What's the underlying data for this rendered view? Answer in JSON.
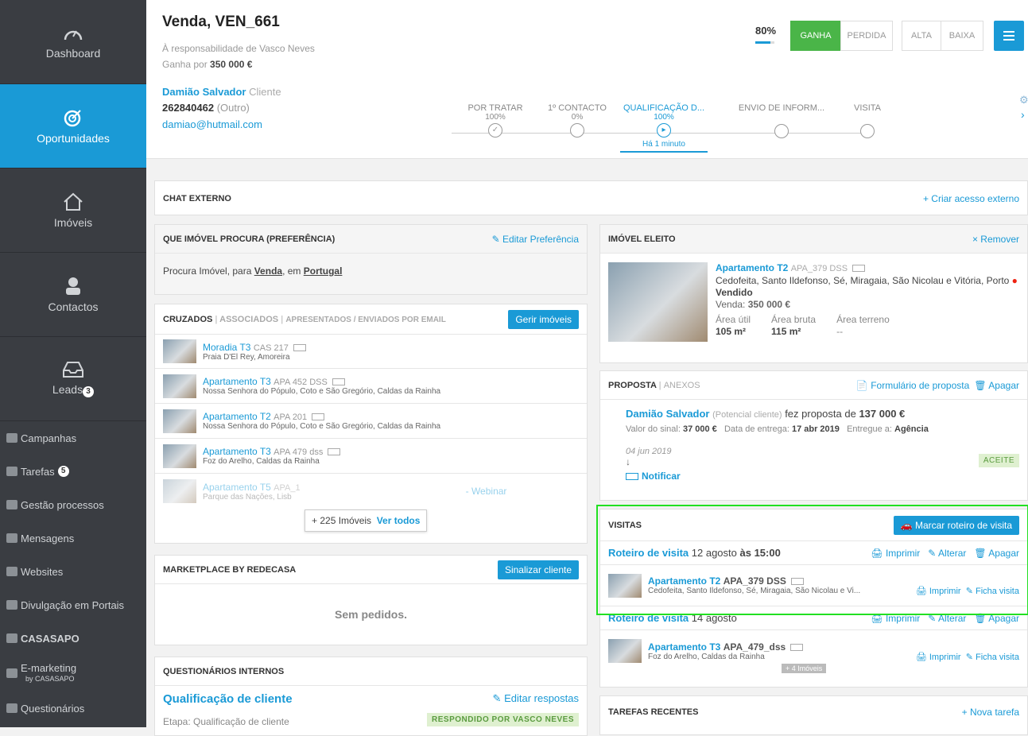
{
  "sidebar": {
    "big": [
      {
        "label": "Dashboard",
        "icon": "gauge-icon"
      },
      {
        "label": "Oportunidades",
        "icon": "target-icon"
      },
      {
        "label": "Imóveis",
        "icon": "house-icon"
      },
      {
        "label": "Contactos",
        "icon": "person-icon"
      },
      {
        "label": "Leads",
        "icon": "inbox-icon",
        "badge": "3"
      }
    ],
    "small": [
      {
        "label": "Campanhas"
      },
      {
        "label": "Tarefas",
        "badge": "5"
      },
      {
        "label": "Gestão processos"
      },
      {
        "label": "Mensagens"
      },
      {
        "label": "Websites"
      },
      {
        "label": "Divulgação em Portais"
      },
      {
        "label": "CASASAPO"
      },
      {
        "label": "E-marketing",
        "sub": "by CASASAPO"
      },
      {
        "label": "Questionários"
      }
    ]
  },
  "header": {
    "title": "Venda, VEN_661",
    "responsible": "À responsabilidade de Vasco Neves",
    "won_prefix": "Ganha por ",
    "won_value": "350 000 €",
    "client_name": "Damião Salvador",
    "client_type": "Cliente",
    "phone": "262840462",
    "phone_type": "(Outro)",
    "email": "damiao@hutmail.com",
    "percent": "80%",
    "btn_won": "GANHA",
    "btn_lost": "PERDIDA",
    "btn_high": "ALTA",
    "btn_low": "BAIXA"
  },
  "stages": [
    {
      "name": "POR TRATAR",
      "pct": "100%"
    },
    {
      "name": "1º CONTACTO",
      "pct": "0%"
    },
    {
      "name": "QUALIFICAÇÃO D...",
      "pct": "100%",
      "when": "Há 1 minuto"
    },
    {
      "name": "ENVIO DE INFORM...",
      "pct": ""
    },
    {
      "name": "VISITA",
      "pct": ""
    }
  ],
  "chat": {
    "title": "CHAT EXTERNO",
    "action": "+ Criar acesso externo"
  },
  "pref": {
    "title": "QUE IMÓVEL PROCURA (PREFERÊNCIA)",
    "action": "Editar Preferência",
    "t1": "Procura Imóvel, para ",
    "venda": "Venda",
    "t2": ", em ",
    "pais": "Portugal"
  },
  "cross": {
    "tab1": "CRUZADOS",
    "tab2": "ASSOCIADOS",
    "tab3": "APRESENTADOS / ENVIADOS POR EMAIL",
    "btn": "Gerir imóveis",
    "items": [
      {
        "title": "Moradia T3",
        "ref": "CAS  217",
        "loc": "Praia D'El Rey, Amoreira"
      },
      {
        "title": "Apartamento T3",
        "ref": "APA  452  DSS",
        "loc": "Nossa Senhora do Pópulo, Coto e São Gregório, Caldas da Rainha"
      },
      {
        "title": "Apartamento T2",
        "ref": "APA  201",
        "loc": "Nossa Senhora do Pópulo, Coto e São Gregório, Caldas da Rainha"
      },
      {
        "title": "Apartamento T3",
        "ref": "APA  479  dss",
        "loc": "Foz do Arelho, Caldas da Rainha"
      },
      {
        "title": "Apartamento T5",
        "ref": "APA_1",
        "loc": "Parque das Nações, Lisb"
      }
    ],
    "more": "+ 225 Imóveis",
    "more_link": "Ver todos",
    "webinar": "- Webinar"
  },
  "market": {
    "title": "MARKETPLACE BY REDECASA",
    "btn": "Sinalizar cliente",
    "empty": "Sem pedidos."
  },
  "quest": {
    "title": "QUESTIONÁRIOS INTERNOS",
    "name": "Qualificação de cliente",
    "action": "Editar respostas",
    "stage": "Etapa: Qualificação de cliente",
    "tag": "RESPONDIDO  POR  VASCO NEVES"
  },
  "elected": {
    "title": "IMÓVEL ELEITO",
    "action": "× Remover",
    "name": "Apartamento T2",
    "ref": "APA_379 DSS",
    "loc": "Cedofeita, Santo Ildefonso, Sé, Miragaia, São Nicolau e Vitória, Porto",
    "sold": "Vendido",
    "sale_lbl": "Venda",
    "sale_val": "350 000 €",
    "a1": "Área útil",
    "v1": "105 m²",
    "a2": "Área bruta",
    "v2": "115 m²",
    "a3": "Área terreno",
    "v3": "--"
  },
  "proposal": {
    "tab1": "PROPOSTA",
    "tab2": "ANEXOS",
    "form": "Formulário de proposta",
    "del": "Apagar",
    "who": "Damião Salvador",
    "who_type": "(Potencial cliente)",
    "text": "fez proposta de",
    "amount": "137 000 €",
    "signal_lbl": "Valor do sinal:",
    "signal": "37 000 €",
    "delivery_lbl": "Data de entrega:",
    "delivery": "17 abr 2019",
    "to_lbl": "Entregue a:",
    "to": "Agência",
    "date": "04 jun 2019",
    "status": "ACEITE",
    "notify": "Notificar"
  },
  "visits": {
    "title": "VISITAS",
    "btn": "Marcar roteiro de visita",
    "routes": [
      {
        "name": "Roteiro de visita",
        "date": "12 agosto",
        "at": "às 15:00",
        "p": "Apartamento T2",
        "ref": "APA_379 DSS",
        "loc": "Cedofeita, Santo Ildefonso, Sé, Miragaia, São Nicolau e Vi..."
      },
      {
        "name": "Roteiro de visita",
        "date": "14 agosto",
        "at": "",
        "p": "Apartamento T3",
        "ref": "APA_479_dss",
        "loc": "Foz do Arelho, Caldas da Rainha",
        "more": "+ 4 Imóveis"
      }
    ],
    "print": "Imprimir",
    "edit": "Alterar",
    "del": "Apagar",
    "sheet": "Ficha visita"
  },
  "tasks": {
    "title": "TAREFAS RECENTES",
    "action": "+ Nova tarefa"
  }
}
